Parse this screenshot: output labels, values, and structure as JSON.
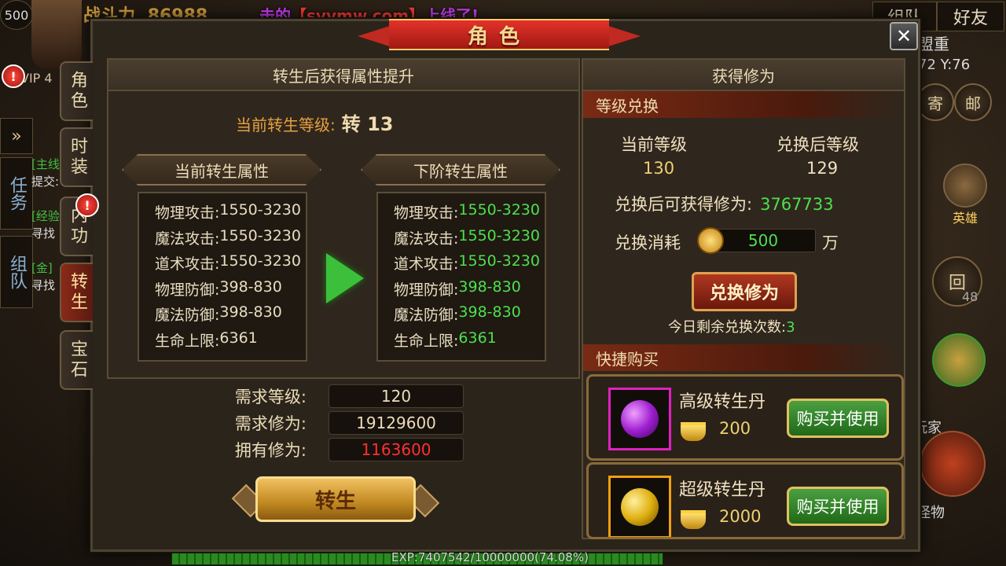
{
  "background_hud": {
    "level_badge": "500",
    "power_label": "战斗力",
    "power_value": "86988",
    "vip_label": "VIP 4",
    "ticker_text_prefix": "击的",
    "ticker_text_url": "【syymw.com】",
    "ticker_text_suffix": "上线了!",
    "top_right_buttons": [
      "组队",
      "好友"
    ],
    "guild_label": "盟重",
    "coords": "72 Y:76",
    "right_buttons": [
      "寄",
      "邮"
    ],
    "hero_label": "英雄",
    "hui_label": "回",
    "hui_count": "48",
    "player_label": "玩家",
    "monster_label": "怪物",
    "left_side_labels": [
      "任务",
      "组队"
    ],
    "left_quest_lines": [
      "[主线]",
      "提交:",
      "[经验]",
      "寻找",
      "[金]",
      "寻找"
    ]
  },
  "panel": {
    "title": "角色",
    "close_label": "✕"
  },
  "tabs": [
    {
      "label": "角色",
      "active": false
    },
    {
      "label": "时装",
      "active": false
    },
    {
      "label": "内功",
      "active": false,
      "alert": "!"
    },
    {
      "label": "转生",
      "active": true
    },
    {
      "label": "宝石",
      "active": false
    }
  ],
  "left_section": {
    "header": "转生后获得属性提升",
    "current_level_label": "当前转生等级:",
    "current_level_value": "转 13",
    "current_attr_title": "当前转生属性",
    "next_attr_title": "下阶转生属性",
    "current_attrs": [
      {
        "name": "物理攻击:",
        "value": "1550-3230"
      },
      {
        "name": "魔法攻击:",
        "value": "1550-3230"
      },
      {
        "name": "道术攻击:",
        "value": "1550-3230"
      },
      {
        "name": "物理防御:",
        "value": "398-830"
      },
      {
        "name": "魔法防御:",
        "value": "398-830"
      },
      {
        "name": "生命上限:",
        "value": "6361"
      }
    ],
    "next_attrs": [
      {
        "name": "物理攻击:",
        "value": "1550-3230"
      },
      {
        "name": "魔法攻击:",
        "value": "1550-3230"
      },
      {
        "name": "道术攻击:",
        "value": "1550-3230"
      },
      {
        "name": "物理防御:",
        "value": "398-830"
      },
      {
        "name": "魔法防御:",
        "value": "398-830"
      },
      {
        "name": "生命上限:",
        "value": "6361"
      }
    ],
    "requirements": [
      {
        "label": "需求等级:",
        "value": "120",
        "warn": false
      },
      {
        "label": "需求修为:",
        "value": "19129600",
        "warn": false
      },
      {
        "label": "拥有修为:",
        "value": "1163600",
        "warn": true
      }
    ],
    "rebirth_button": "转生"
  },
  "right_section": {
    "header": "获得修为",
    "exchange_header": "等级兑换",
    "current_level_label": "当前等级",
    "current_level_value": "130",
    "after_level_label": "兑换后等级",
    "after_level_value": "129",
    "gain_label": "兑换后可获得修为:",
    "gain_value": "3767733",
    "cost_label": "兑换消耗",
    "cost_value": "500",
    "cost_unit": "万",
    "exchange_button": "兑换修为",
    "remaining_label": "今日剩余兑换次数:",
    "remaining_value": "3",
    "quick_buy_header": "快捷购买",
    "items": [
      {
        "name": "高级转生丹",
        "price": "200",
        "button": "购买并使用",
        "gem_color": "#a020d0",
        "frame_color": "#e020c0"
      },
      {
        "name": "超级转生丹",
        "price": "2000",
        "button": "购买并使用",
        "gem_color": "#e0b010",
        "frame_color": "#f0a010"
      }
    ]
  },
  "exp_bar": {
    "text": "EXP:7407542/10000000(74.08%)",
    "fraction": 0.7408
  }
}
